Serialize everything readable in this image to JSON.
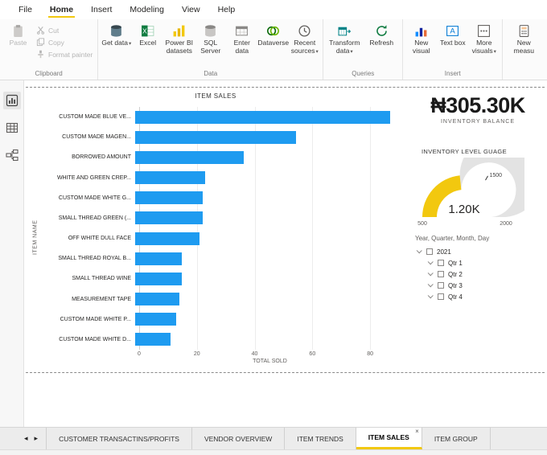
{
  "glyphs": {
    "caret": "▾",
    "close": "×",
    "arrow_left": "◂",
    "arrow_right": "▸"
  },
  "menubar": {
    "items": [
      {
        "label": "File",
        "active": false
      },
      {
        "label": "Home",
        "active": true
      },
      {
        "label": "Insert",
        "active": false
      },
      {
        "label": "Modeling",
        "active": false
      },
      {
        "label": "View",
        "active": false
      },
      {
        "label": "Help",
        "active": false
      }
    ]
  },
  "ribbon": {
    "clipboard": {
      "label": "Clipboard",
      "paste": "Paste",
      "cut": "Cut",
      "copy": "Copy",
      "format_painter": "Format painter"
    },
    "data": {
      "label": "Data",
      "items": [
        {
          "label": "Get data",
          "dropdown": true
        },
        {
          "label": "Excel",
          "dropdown": false
        },
        {
          "label": "Power BI datasets",
          "dropdown": false
        },
        {
          "label": "SQL Server",
          "dropdown": false
        },
        {
          "label": "Enter data",
          "dropdown": false
        },
        {
          "label": "Dataverse",
          "dropdown": false
        },
        {
          "label": "Recent sources",
          "dropdown": true
        }
      ]
    },
    "queries": {
      "label": "Queries",
      "items": [
        {
          "label": "Transform data",
          "dropdown": true
        },
        {
          "label": "Refresh",
          "dropdown": false
        }
      ]
    },
    "insert": {
      "label": "Insert",
      "items": [
        {
          "label": "New visual",
          "dropdown": false
        },
        {
          "label": "Text box",
          "dropdown": false
        },
        {
          "label": "More visuals",
          "dropdown": true
        }
      ]
    },
    "calculations": {
      "items": [
        {
          "label": "New measu"
        }
      ]
    }
  },
  "chart_data": [
    {
      "type": "bar",
      "orientation": "horizontal",
      "title": "ITEM SALES",
      "xlabel": "TOTAL SOLD",
      "ylabel": "ITEM NAME",
      "categories": [
        "CUSTOM MADE BLUE VE...",
        "CUSTOM MADE MAGEN...",
        "BORROWED AMOUNT",
        "WHITE AND GREEN CREP...",
        "CUSTOM MADE WHITE G...",
        "SMALL THREAD GREEN (...",
        "OFF WHITE DULL FACE",
        "SMALL THREAD ROYAL B...",
        "SMALL THREAD WINE",
        "MEASUREMENT TAPE",
        "CUSTOM MADE WHITE P...",
        "CUSTOM MADE WHITE D..."
      ],
      "values": [
        87,
        55,
        37,
        24,
        23,
        23,
        22,
        16,
        16,
        15,
        14,
        12
      ],
      "xlim": [
        0,
        90
      ],
      "xticks": [
        0,
        20,
        40,
        60,
        80
      ],
      "bar_color": "#1E9BF0",
      "grid": true,
      "legend": "none"
    },
    {
      "type": "card",
      "value": "₦305.30K",
      "label": "INVENTORY BALANCE"
    },
    {
      "type": "gauge",
      "title": "INVENTORY LEVEL GUAGE",
      "min": 500,
      "max": 2000,
      "value": 1200,
      "value_label": "1.20K",
      "target": 1500,
      "fill_color": "#F2C80F",
      "track_color": "#E3E3E3"
    },
    {
      "type": "slicer",
      "header": "Year, Quarter, Month, Day",
      "items": [
        {
          "label": "2021",
          "level": 0,
          "checked": false
        },
        {
          "label": "Qtr 1",
          "level": 1,
          "checked": false
        },
        {
          "label": "Qtr 2",
          "level": 1,
          "checked": false
        },
        {
          "label": "Qtr 3",
          "level": 1,
          "checked": false
        },
        {
          "label": "Qtr 4",
          "level": 1,
          "checked": false
        }
      ]
    }
  ],
  "page_tabs": {
    "tabs": [
      {
        "label": "CUSTOMER TRANSACTINS/PROFITS",
        "active": false
      },
      {
        "label": "VENDOR OVERVIEW",
        "active": false
      },
      {
        "label": "ITEM TRENDS",
        "active": false
      },
      {
        "label": "ITEM SALES",
        "active": true,
        "closable": true
      },
      {
        "label": "ITEM GROUP",
        "active": false
      }
    ]
  }
}
